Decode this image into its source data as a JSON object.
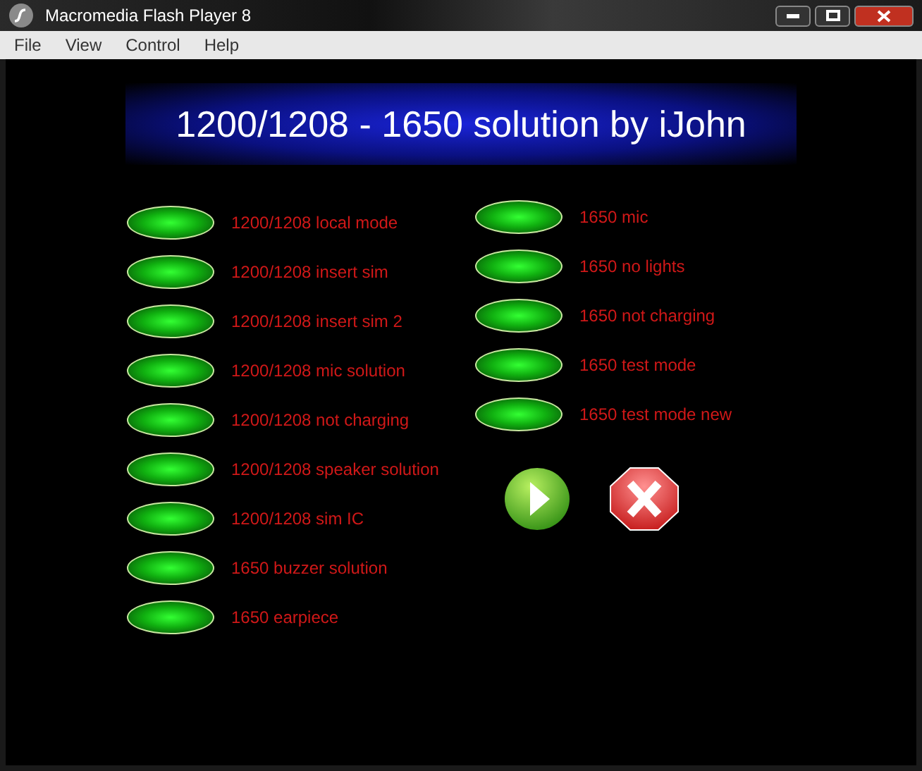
{
  "window": {
    "title": "Macromedia Flash Player 8"
  },
  "menu": [
    "File",
    "View",
    "Control",
    "Help"
  ],
  "banner": {
    "title": "1200/1208 - 1650 solution by iJohn"
  },
  "left_options": [
    {
      "label": "1200/1208 local mode"
    },
    {
      "label": "1200/1208 insert sim"
    },
    {
      "label": "1200/1208 insert sim 2"
    },
    {
      "label": "1200/1208 mic solution"
    },
    {
      "label": "1200/1208 not charging"
    },
    {
      "label": "1200/1208 speaker solution"
    },
    {
      "label": "1200/1208 sim IC"
    },
    {
      "label": "1650 buzzer solution"
    },
    {
      "label": "1650 earpiece"
    }
  ],
  "right_options": [
    {
      "label": "1650 mic"
    },
    {
      "label": "1650 no lights"
    },
    {
      "label": "1650 not charging"
    },
    {
      "label": "1650 test mode"
    },
    {
      "label": "1650 test mode new"
    }
  ]
}
